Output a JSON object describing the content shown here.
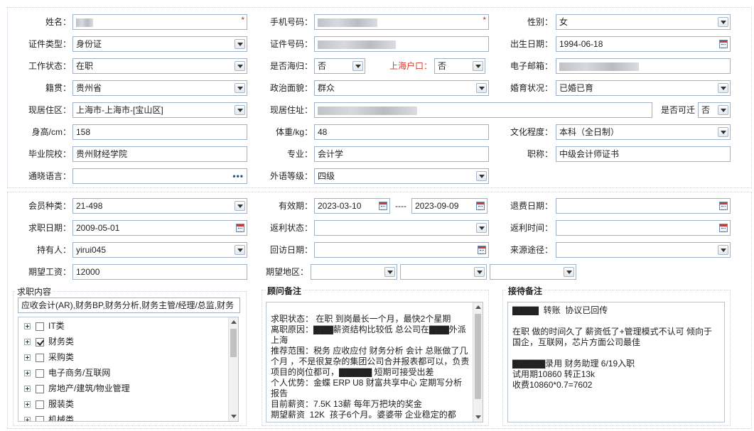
{
  "section1": {
    "name": {
      "label": "姓名："
    },
    "phone": {
      "label": "手机号码："
    },
    "gender": {
      "label": "性别：",
      "value": "女"
    },
    "id_type": {
      "label": "证件类型：",
      "value": "身份证"
    },
    "id_no": {
      "label": "证件号码："
    },
    "birth": {
      "label": "出生日期：",
      "value": "1994-06-18"
    },
    "work_status": {
      "label": "工作状态：",
      "value": "在职"
    },
    "returnee": {
      "label": "是否海归：",
      "value": "否"
    },
    "sh_hukou": {
      "label": "上海户口：",
      "value": "否"
    },
    "email": {
      "label": "电子邮箱："
    },
    "native": {
      "label": "籍贯：",
      "value": "贵州省"
    },
    "political": {
      "label": "政治面貌：",
      "value": "群众"
    },
    "marital": {
      "label": "婚育状况：",
      "value": "已婚已育"
    },
    "residence": {
      "label": "现居住区：",
      "value": "上海市-上海市-[宝山区]"
    },
    "address": {
      "label": "现居住址："
    },
    "can_go": {
      "label": "是否可迁",
      "value": "否"
    },
    "height": {
      "label": "身高/cm：",
      "value": "158"
    },
    "weight": {
      "label": "体重/kg：",
      "value": "48"
    },
    "education": {
      "label": "文化程度：",
      "value": "本科（全日制）"
    },
    "school": {
      "label": "毕业院校：",
      "value": "贵州财经学院"
    },
    "major": {
      "label": "专业：",
      "value": "会计学"
    },
    "title": {
      "label": "职称：",
      "value": "中级会计师证书"
    },
    "language": {
      "label": "通晓语言：",
      "value": "",
      "more": "•••"
    },
    "foreign_level": {
      "label": "外语等级：",
      "value": "四级"
    }
  },
  "section2": {
    "member_type": {
      "label": "会员种类：",
      "value": "21-498"
    },
    "validity": {
      "label": "有效期：",
      "from": "2023-03-10",
      "sep": "----",
      "to": "2023-09-09"
    },
    "refund_date": {
      "label": "退费日期："
    },
    "job_date": {
      "label": "求职日期：",
      "value": "2009-05-01"
    },
    "rebate_status": {
      "label": "返利状态："
    },
    "rebate_time": {
      "label": "返利时间："
    },
    "holder": {
      "label": "持有人：",
      "value": "yirui045"
    },
    "visit_date": {
      "label": "回访日期："
    },
    "source": {
      "label": "来源途径："
    },
    "salary": {
      "label": "期望工资：",
      "value": "12000"
    },
    "region": {
      "label": "期望地区："
    }
  },
  "job_content": {
    "title": "求职内容",
    "selected": "应收会计(AR),财务BP,财务分析,财务主管/经理/总监,财务",
    "items": [
      {
        "label": "IT类",
        "checked": false
      },
      {
        "label": "财务类",
        "checked": true
      },
      {
        "label": "采购类",
        "checked": false
      },
      {
        "label": "电子商务/互联网",
        "checked": false
      },
      {
        "label": "房地产/建筑/物业管理",
        "checked": false
      },
      {
        "label": "服装类",
        "checked": false
      },
      {
        "label": "机械类",
        "checked": false
      }
    ]
  },
  "advisor_notes": {
    "title": "顾问备注",
    "text": "求职状态： 在职 到岗最长一个月，最快2个星期\n离职原因：▇▇▇薪资结构比较低 总公司在▇▇▇外派上海\n推荐范围：税务 应收应付 财务分析 会计 总账做了几个月 ，不是很复杂的集团公司合并报表都可以，负责项目的岗位都可，▇▇▇▇▇ 短期可接受出差\n个人优势：金蝶 ERP U8 财富共享中心 定期写分析报告\n目前薪资：7.5K 13薪 每年万把块的奖金\n期望薪资  12K  孩子6个月。婆婆带 企业稳定的都"
  },
  "reception_notes": {
    "title": "接待备注",
    "text": "▇▇▇▇  转账  协议已回传\n\n在职 做的时间久了 薪资低了+管理模式不认可 倾向于国企，互联网，芯片方面公司最佳\n\n▇▇▇▇▇录用 财务助理 6/19入职\n试用期10860 转正13k\n收费10860*0.7=7602"
  }
}
